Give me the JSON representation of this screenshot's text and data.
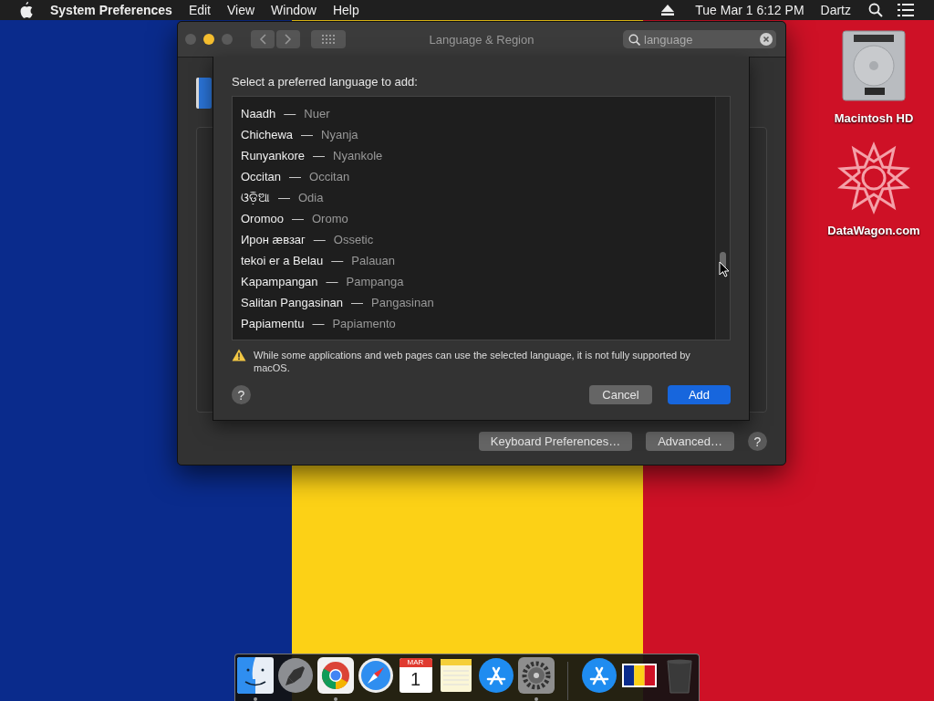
{
  "menu_bar": {
    "app": "System Preferences",
    "menus": [
      "Edit",
      "View",
      "Window",
      "Help"
    ],
    "clock": "Tue Mar 1  6:12 PM",
    "user": "Dartz"
  },
  "window": {
    "title": "Language & Region",
    "search": {
      "value": "language"
    },
    "buttons": [
      "Keyboard Preferences…",
      "Advanced…"
    ],
    "help": "?"
  },
  "sheet": {
    "prompt": "Select a preferred language to add:",
    "separator": "—",
    "languages": [
      {
        "native": "Naadh",
        "english": "Nuer",
        "selected": false
      },
      {
        "native": "Chichewa",
        "english": "Nyanja",
        "selected": false
      },
      {
        "native": "Runyankore",
        "english": "Nyankole",
        "selected": false
      },
      {
        "native": "Occitan",
        "english": "Occitan",
        "selected": false
      },
      {
        "native": "ଓଡ଼ିଆ",
        "english": "Odia",
        "selected": false
      },
      {
        "native": "Oromoo",
        "english": "Oromo",
        "selected": false
      },
      {
        "native": "Ирон æвзаг",
        "english": "Ossetic",
        "selected": false
      },
      {
        "native": "tekoi er a Belau",
        "english": "Palauan",
        "selected": false
      },
      {
        "native": "Kapampangan",
        "english": "Pampanga",
        "selected": false
      },
      {
        "native": "Salitan Pangasinan",
        "english": "Pangasinan",
        "selected": false
      },
      {
        "native": "Papiamentu",
        "english": "Papiamento",
        "selected": false
      }
    ],
    "warning": "While some applications and web pages can use the selected language, it is not fully supported by macOS.",
    "help": "?",
    "buttons": [
      {
        "label": "Cancel",
        "kind": "normal"
      },
      {
        "label": "Add",
        "kind": "default"
      }
    ]
  },
  "desktop_icons": [
    {
      "label": "Macintosh HD",
      "kind": "disk"
    },
    {
      "label": "DataWagon.com",
      "kind": "emblem"
    }
  ],
  "dock": [
    {
      "kind": "finder",
      "running": true
    },
    {
      "kind": "launchpad",
      "running": false
    },
    {
      "kind": "chrome",
      "running": true
    },
    {
      "kind": "safari",
      "running": false
    },
    {
      "kind": "calendar",
      "running": false,
      "month": "MAR",
      "day": "1"
    },
    {
      "kind": "notes",
      "running": false
    },
    {
      "kind": "appstore",
      "running": false
    },
    {
      "kind": "sysprefs",
      "running": true
    },
    {
      "kind": "separator"
    },
    {
      "kind": "appstore",
      "running": false
    },
    {
      "kind": "flag",
      "running": false
    },
    {
      "kind": "trash",
      "running": false
    }
  ]
}
